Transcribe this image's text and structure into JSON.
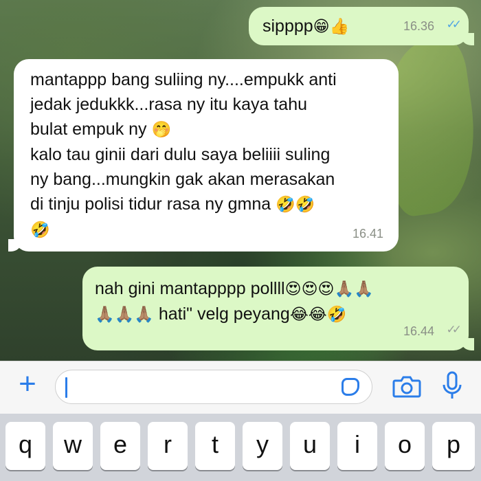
{
  "messages": [
    {
      "id": "m1",
      "direction": "outgoing",
      "text": "sipppp",
      "emojis": "😁👍",
      "time": "16.36",
      "status": "read"
    },
    {
      "id": "m2",
      "direction": "incoming",
      "lines": [
        "mantappp bang suliing ny....empukk anti",
        "jedak jedukkk...rasa ny itu kaya tahu",
        "bulat empuk ny",
        "kalo tau ginii dari dulu saya beliiii suling",
        "ny bang...mungkin gak akan merasakan",
        "di tinju polisi tidur rasa ny gmna"
      ],
      "line3_emoji": "🤭",
      "line6_emojis": "🤣🤣",
      "line7_emoji": "🤣",
      "time": "16.41"
    },
    {
      "id": "m3",
      "direction": "outgoing",
      "line1_text": "nah gini mantapppp pollll",
      "line1_emojis": "😍😍😍🙏🏽🙏🏽",
      "line2_emojis": "🙏🏽🙏🏽🙏🏽",
      "line2_text": "hati\" velg peyang",
      "line2_end_emojis": "😂😂🤣",
      "time": "16.44",
      "status": "sent"
    }
  ],
  "input": {
    "value": "",
    "placeholder": ""
  },
  "icons": {
    "attach": "plus-icon",
    "sticker": "sticker-icon",
    "camera": "camera-icon",
    "mic": "microphone-icon"
  },
  "keyboard": {
    "row1": [
      "q",
      "w",
      "e",
      "r",
      "t",
      "y",
      "u",
      "i",
      "o",
      "p"
    ]
  },
  "colors": {
    "outgoing_bubble": "#dcf8c6",
    "incoming_bubble": "#ffffff",
    "accent": "#2b7de9",
    "read_ticks": "#4fa3e3"
  }
}
